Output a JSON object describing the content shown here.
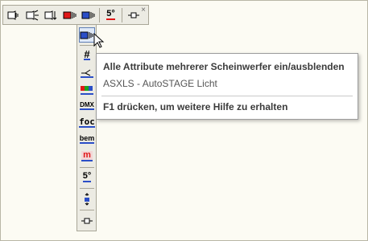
{
  "toolbar": {
    "buttons": [
      {
        "icon": "spotlight-left-icon"
      },
      {
        "icon": "spotlight-right-icon"
      },
      {
        "icon": "spotlight-down-icon"
      },
      {
        "icon": "red-spotlight-icon"
      },
      {
        "icon": "blue-spotlight-icon"
      },
      {
        "icon": "five-degree-icon",
        "label": "5°"
      },
      {
        "icon": "pin-icon"
      }
    ],
    "close_label": "×"
  },
  "vertical_toolbar": {
    "items": [
      {
        "icon": "show-all-attributes-icon",
        "active": true
      },
      {
        "icon": "number-icon",
        "label": "#"
      },
      {
        "icon": "beam-icon"
      },
      {
        "icon": "color-icon"
      },
      {
        "icon": "dmx-icon",
        "label": "DMX"
      },
      {
        "icon": "focus-icon",
        "label": "foc"
      },
      {
        "icon": "bem-icon",
        "label": "bem"
      },
      {
        "icon": "m-icon",
        "label": "m"
      },
      {
        "icon": "five-degree-icon",
        "label": "5°"
      },
      {
        "icon": "height-icon"
      },
      {
        "icon": "pin-icon"
      }
    ]
  },
  "tooltip": {
    "title": "Alle Attribute mehrerer Scheinwerfer ein/ausblenden",
    "subtitle": "ASXLS - AutoSTAGE Licht",
    "help": "F1 drücken, um weitere Hilfe zu erhalten"
  },
  "colors": {
    "accent_blue": "#2b4ec7",
    "accent_red": "#e01818",
    "tooltip_border": "#9c9c9c",
    "toolbar_bg": "#ecebe3"
  }
}
